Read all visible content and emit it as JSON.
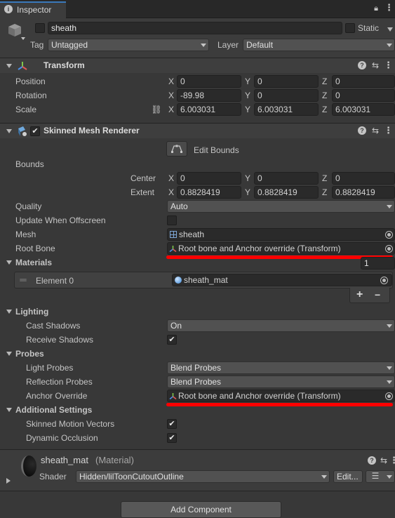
{
  "tab": {
    "title": "Inspector"
  },
  "object": {
    "name": "sheath",
    "static_label": "Static",
    "tag_label": "Tag",
    "tag_value": "Untagged",
    "layer_label": "Layer",
    "layer_value": "Default"
  },
  "transform": {
    "title": "Transform",
    "position_label": "Position",
    "position": {
      "x": "0",
      "y": "0",
      "z": "0"
    },
    "rotation_label": "Rotation",
    "rotation": {
      "x": "-89.98",
      "y": "0",
      "z": "0"
    },
    "scale_label": "Scale",
    "scale": {
      "x": "6.003031",
      "y": "6.003031",
      "z": "6.003031"
    }
  },
  "axis": {
    "x": "X",
    "y": "Y",
    "z": "Z"
  },
  "smr": {
    "title": "Skinned Mesh Renderer",
    "edit_bounds": "Edit Bounds",
    "bounds_label": "Bounds",
    "center_label": "Center",
    "center": {
      "x": "0",
      "y": "0",
      "z": "0"
    },
    "extent_label": "Extent",
    "extent": {
      "x": "0.8828419",
      "y": "0.8828419",
      "z": "0.8828419"
    },
    "quality_label": "Quality",
    "quality_value": "Auto",
    "update_offscreen_label": "Update When Offscreen",
    "mesh_label": "Mesh",
    "mesh_value": "sheath",
    "root_bone_label": "Root Bone",
    "root_bone_value": "Root bone and Anchor override (Transform)",
    "materials_label": "Materials",
    "materials_count": "1",
    "element0_label": "Element 0",
    "element0_value": "sheath_mat",
    "plus": "+",
    "minus": "−",
    "lighting_label": "Lighting",
    "cast_shadows_label": "Cast Shadows",
    "cast_shadows_value": "On",
    "receive_shadows_label": "Receive Shadows",
    "probes_label": "Probes",
    "light_probes_label": "Light Probes",
    "light_probes_value": "Blend Probes",
    "reflection_probes_label": "Reflection Probes",
    "reflection_probes_value": "Blend Probes",
    "anchor_override_label": "Anchor Override",
    "anchor_override_value": "Root bone and Anchor override (Transform)",
    "additional_label": "Additional Settings",
    "motion_vectors_label": "Skinned Motion Vectors",
    "dynamic_occlusion_label": "Dynamic Occlusion"
  },
  "material": {
    "name": "sheath_mat",
    "type": "(Material)",
    "shader_label": "Shader",
    "shader_value": "Hidden/lilToonCutoutOutline",
    "edit_label": "Edit..."
  },
  "add_component": "Add Component",
  "check_glyph": "✔"
}
